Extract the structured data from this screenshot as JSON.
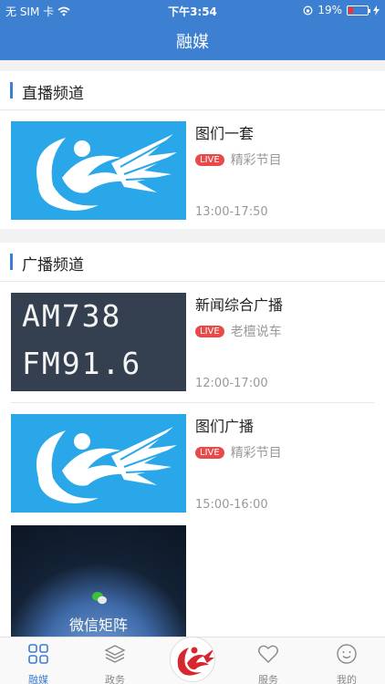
{
  "status": {
    "carrier": "无 SIM 卡",
    "time": "下午3:54",
    "battery": "19%"
  },
  "navbar": {
    "title": "融媒"
  },
  "sections": [
    {
      "title": "直播频道",
      "items": [
        {
          "name": "图们一套",
          "live": "LIVE",
          "program": "精彩节目",
          "time": "13:00-17:50"
        }
      ]
    },
    {
      "title": "广播频道",
      "items": [
        {
          "name": "新闻综合广播",
          "live": "LIVE",
          "program": "老檀说车",
          "time": "12:00-17:00",
          "thumb_lines": [
            "AM738",
            "FM91.6"
          ]
        },
        {
          "name": "图们广播",
          "live": "LIVE",
          "program": "精彩节目",
          "time": "15:00-16:00"
        },
        {
          "caption": "微信矩阵"
        }
      ]
    }
  ],
  "tabs": [
    {
      "label": "融媒",
      "icon": "grid-icon"
    },
    {
      "label": "政务",
      "icon": "layers-icon"
    },
    {
      "label": "",
      "icon": "logo-icon"
    },
    {
      "label": "服务",
      "icon": "heart-icon"
    },
    {
      "label": "我的",
      "icon": "smiley-icon"
    }
  ],
  "colors": {
    "brand": "#3d7fd0",
    "live": "#e84a4a",
    "thumb_blue": "#29a7e8"
  }
}
